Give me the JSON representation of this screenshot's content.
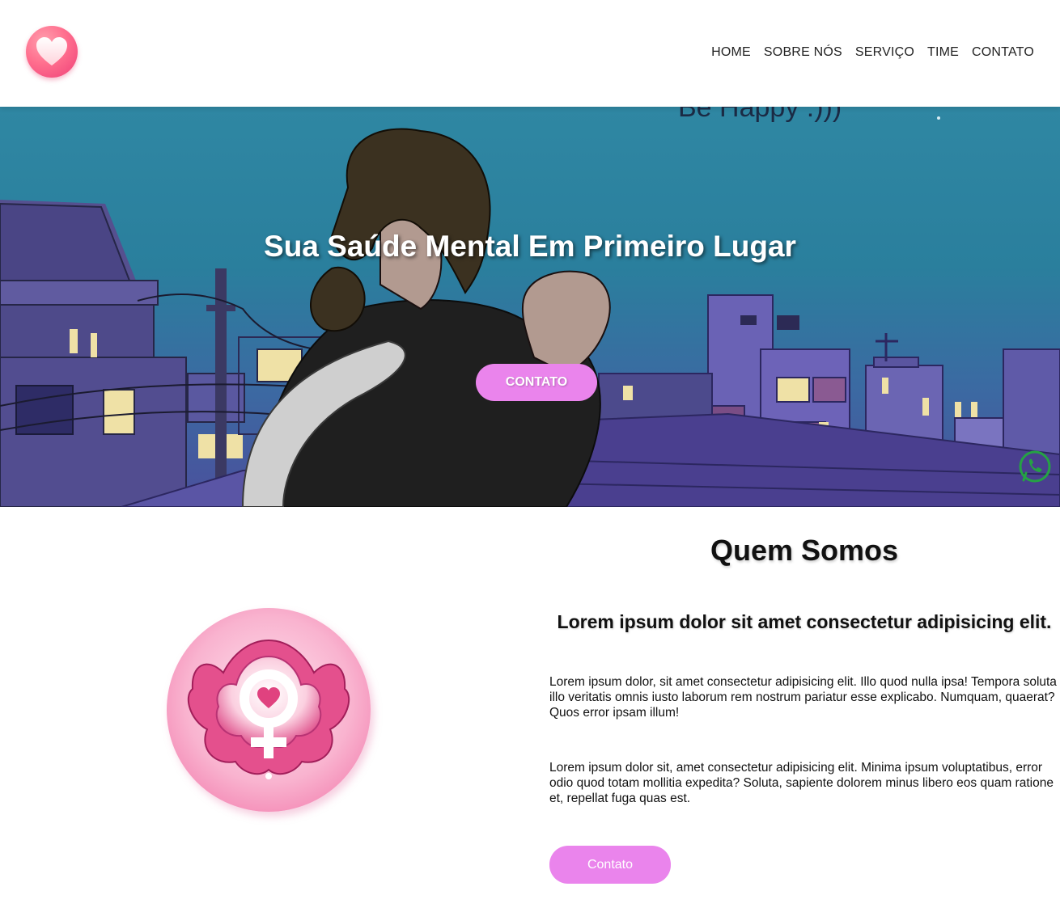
{
  "header": {
    "logo_icon": "heart-icon",
    "nav": [
      {
        "label": "HOME"
      },
      {
        "label": "SOBRE NÓS"
      },
      {
        "label": "SERVIÇO"
      },
      {
        "label": "TIME"
      },
      {
        "label": "CONTATO"
      }
    ]
  },
  "hero": {
    "background_text": "Be Happy :)))",
    "title": "Sua Saúde Mental Em Primeiro Lugar",
    "button_label": "CONTATO",
    "whatsapp_icon": "whatsapp-icon"
  },
  "about": {
    "title": "Quem Somos",
    "subtitle": "Lorem ipsum dolor sit amet consectetur adipisicing elit.",
    "paragraphs": [
      "Lorem ipsum dolor, sit amet consectetur adipisicing elit. Illo quod nulla ipsa! Tempora soluta illo veritatis omnis iusto laborum rem nostrum pariatur esse explicabo. Numquam, quaerat? Quos error ipsam illum!",
      "Lorem ipsum dolor sit, amet consectetur adipisicing elit. Minima ipsum voluptatibus, error odio quod totam mollitia expedita? Soluta, sapiente dolorem minus libero eos quam ratione et, repellat fuga quas est."
    ],
    "image_icon": "female-symbol-icon",
    "button_label": "Contato"
  },
  "colors": {
    "accent_button": "#ea84ec",
    "logo_pink": "#ee3f78",
    "whatsapp_green": "#25a244"
  }
}
